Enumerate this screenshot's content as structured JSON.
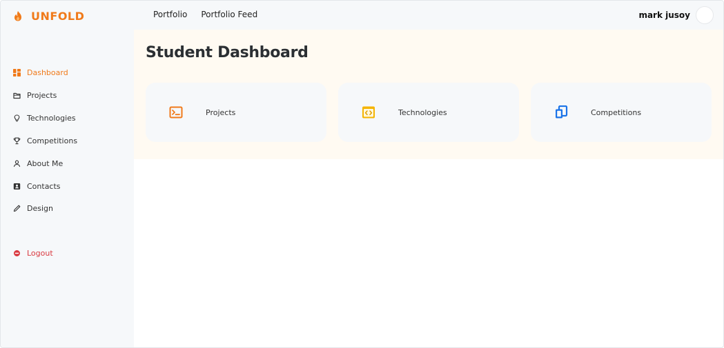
{
  "brand": {
    "name": "UNFOLD"
  },
  "topnav": {
    "items": [
      "Portfolio",
      "Portfolio Feed"
    ]
  },
  "user": {
    "name": "mark jusoy"
  },
  "sidebar": {
    "items": [
      {
        "label": "Dashboard",
        "icon": "grid-icon",
        "active": true
      },
      {
        "label": "Projects",
        "icon": "folder-icon"
      },
      {
        "label": "Technologies",
        "icon": "lightbulb-icon"
      },
      {
        "label": "Competitions",
        "icon": "trophy-icon"
      },
      {
        "label": "About Me",
        "icon": "user-icon"
      },
      {
        "label": "Contacts",
        "icon": "contact-card-icon"
      },
      {
        "label": "Design",
        "icon": "pen-icon"
      }
    ],
    "logout": {
      "label": "Logout",
      "icon": "logout-icon"
    }
  },
  "main": {
    "title": "Student Dashboard",
    "cards": [
      {
        "label": "Projects",
        "icon": "terminal-icon",
        "color": "#f07a1a"
      },
      {
        "label": "Technologies",
        "icon": "code-window-icon",
        "color": "#f5b400"
      },
      {
        "label": "Competitions",
        "icon": "copy-icon",
        "color": "#1a73e8"
      }
    ]
  },
  "colors": {
    "accent": "#f07a1a",
    "logout": "#d9393f",
    "sidebar_bg": "#f6f8fa",
    "hero_bg": "#fffaf2"
  }
}
